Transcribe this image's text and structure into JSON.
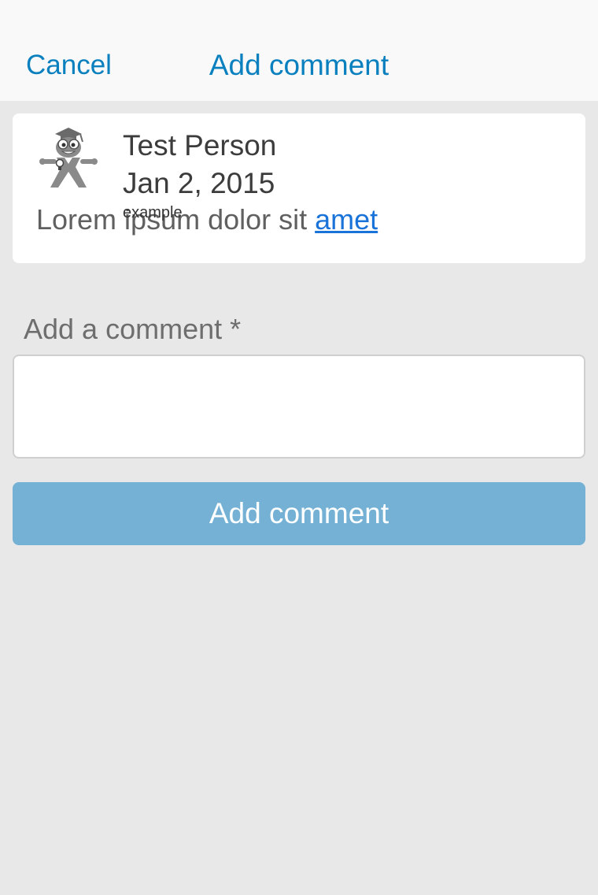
{
  "nav": {
    "cancel_label": "Cancel",
    "title": "Add comment"
  },
  "comment": {
    "avatar_icon": "graduate-mascot-icon",
    "author": "Test Person",
    "date": "Jan 2, 2015",
    "body_text": "Lorem ipsum dolor sit ",
    "body_link": "amet",
    "overlay_label": "example"
  },
  "form": {
    "label": "Add a comment *",
    "input_value": "",
    "input_placeholder": "",
    "submit_label": "Add comment"
  },
  "colors": {
    "accent": "#0a80bf",
    "link": "#1a73d9",
    "button_bg": "#74b1d5",
    "page_bg": "#e8e8e8",
    "navbar_bg": "#f9f9f9"
  }
}
